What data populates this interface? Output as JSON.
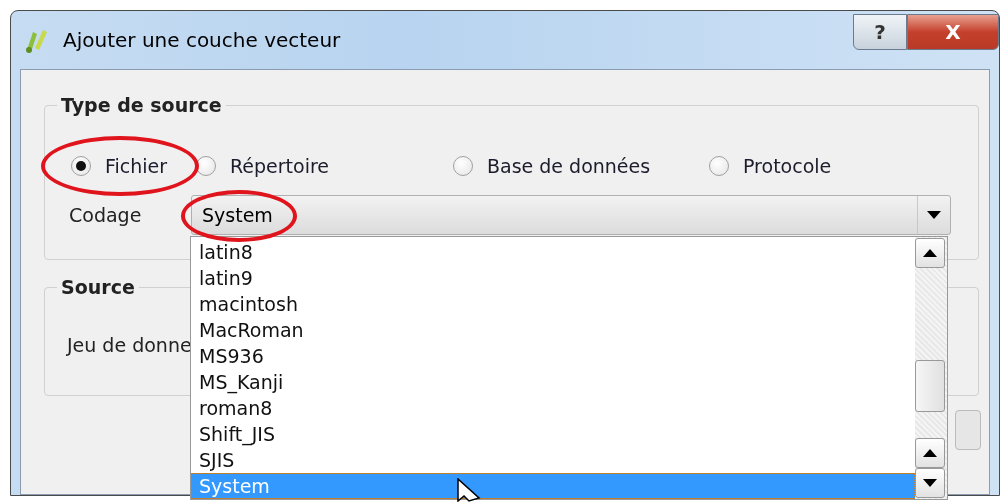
{
  "window": {
    "title": "Ajouter une couche vecteur",
    "help_button": "?",
    "close_button": "X"
  },
  "source_type": {
    "title": "Type de source",
    "options": [
      {
        "label": "Fichier",
        "selected": true
      },
      {
        "label": "Répertoire",
        "selected": false
      },
      {
        "label": "Base de données",
        "selected": false
      },
      {
        "label": "Protocole",
        "selected": false
      }
    ]
  },
  "encoding": {
    "label": "Codage",
    "value": "System",
    "expanded": true,
    "options": [
      {
        "label": "latin8",
        "selected": false
      },
      {
        "label": "latin9",
        "selected": false
      },
      {
        "label": "macintosh",
        "selected": false
      },
      {
        "label": "MacRoman",
        "selected": false
      },
      {
        "label": "MS936",
        "selected": false
      },
      {
        "label": "MS_Kanji",
        "selected": false
      },
      {
        "label": "roman8",
        "selected": false
      },
      {
        "label": "Shift_JIS",
        "selected": false
      },
      {
        "label": "SJIS",
        "selected": false
      },
      {
        "label": "System",
        "selected": true
      }
    ]
  },
  "source": {
    "title": "Source",
    "dataset_label": "Jeu de donne"
  }
}
